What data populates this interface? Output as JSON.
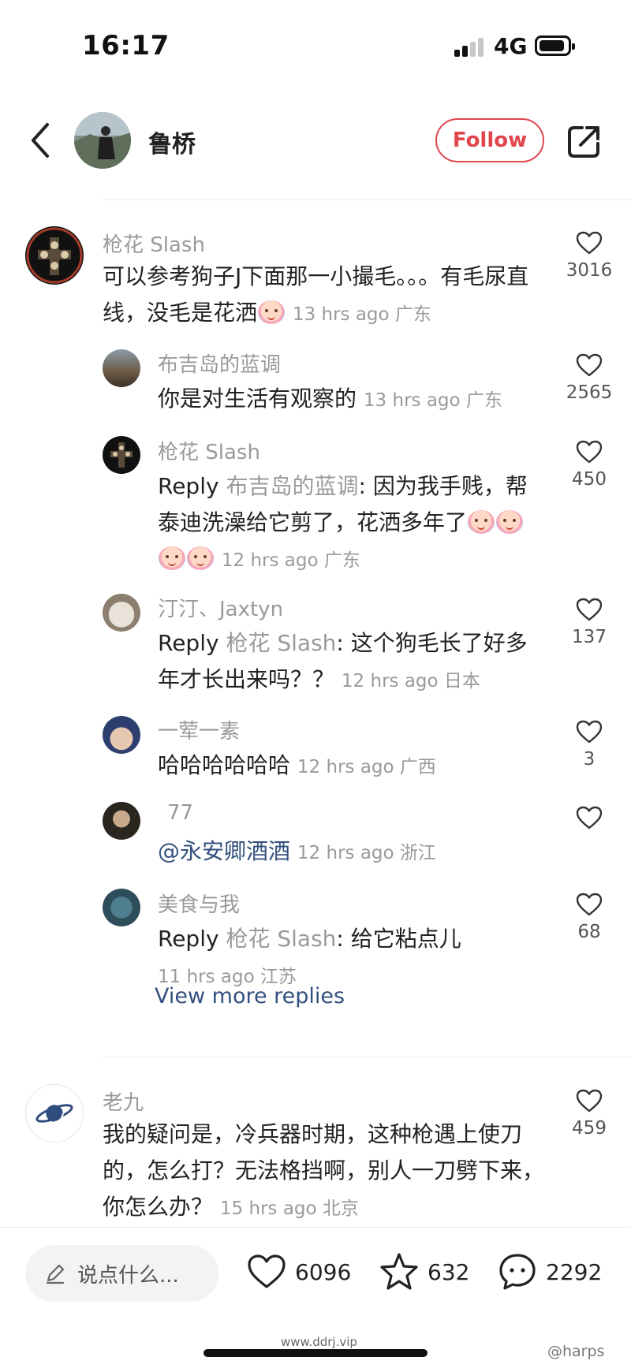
{
  "status_bar": {
    "time": "16:17",
    "network": "4G"
  },
  "header": {
    "user_name": "鲁桥",
    "follow_label": "Follow"
  },
  "comments": [
    {
      "author": "枪花 Slash",
      "text": "可以参考狗子J下面那一小撮毛。。。有毛尿直线，没毛是花洒",
      "emoji_count": 1,
      "time": "13 hrs ago 广东",
      "likes": "3016",
      "replies": [
        {
          "author": "布吉岛的蓝调",
          "text": "你是对生活有观察的",
          "time": "13 hrs ago 广东",
          "likes": "2565"
        },
        {
          "author": "枪花 Slash",
          "reply_label": "Reply",
          "reply_to": "布吉岛的蓝调",
          "text": "因为我手贱，帮泰迪洗澡给它剪了，花洒多年了",
          "emoji_count": 4,
          "time": "12 hrs ago 广东",
          "likes": "450"
        },
        {
          "author": "汀汀、Jaxtyn",
          "reply_label": "Reply",
          "reply_to": "枪花 Slash",
          "text": "这个狗毛长了好多年才长出来吗？？",
          "time": "12 hrs ago 日本",
          "likes": "137"
        },
        {
          "author": "一荤一素",
          "text": "哈哈哈哈哈哈",
          "time": "12 hrs ago 广西",
          "likes": "3"
        },
        {
          "author": "77",
          "mention": "@永安卿酒酒",
          "time": "12 hrs ago 浙江",
          "likes": ""
        },
        {
          "author": "美食与我",
          "reply_label": "Reply",
          "reply_to": "枪花 Slash",
          "text": "给它粘点儿",
          "time": "11 hrs ago 江苏",
          "likes": "68"
        }
      ],
      "view_more_label": "View more replies"
    },
    {
      "author": "老九",
      "text": "我的疑问是，冷兵器时期，这种枪遇上使刀的，怎么打？无法格挡啊，别人一刀劈下来，你怎么办？",
      "time": "15 hrs ago 北京",
      "likes": "459"
    }
  ],
  "bottom_bar": {
    "input_placeholder": "说点什么...",
    "likes": "6096",
    "favorites": "632",
    "comments": "2292"
  },
  "watermarks": {
    "left": "www.ddrj.vip",
    "right": "@harps"
  },
  "colors": {
    "accent": "#e0464c",
    "link": "#33507e",
    "muted": "#9a9a9a"
  },
  "icons": [
    "back-arrow-icon",
    "share-icon",
    "heart-icon",
    "pencil-icon",
    "star-icon",
    "chat-bubble-icon",
    "planet-icon"
  ]
}
